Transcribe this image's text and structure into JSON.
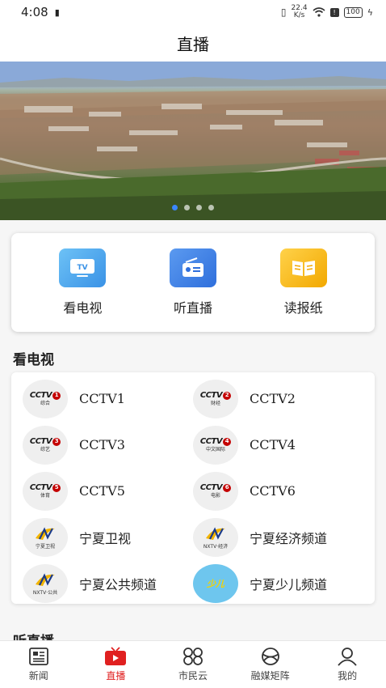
{
  "status": {
    "time": "4:08",
    "speed_value": "22.4",
    "speed_unit": "K/s",
    "battery": "100"
  },
  "header": {
    "title": "直播"
  },
  "quick_actions": [
    {
      "label": "看电视",
      "icon": "tv-icon",
      "color": "#4aa8f0"
    },
    {
      "label": "听直播",
      "icon": "radio-icon",
      "color": "#3c7fe6"
    },
    {
      "label": "读报纸",
      "icon": "newspaper-icon",
      "color": "#f4b300"
    }
  ],
  "tv_section": {
    "title": "看电视",
    "channels": [
      {
        "name": "CCTV1",
        "logo": "1",
        "sub": "综合"
      },
      {
        "name": "CCTV2",
        "logo": "2",
        "sub": "财经"
      },
      {
        "name": "CCTV3",
        "logo": "3",
        "sub": "综艺"
      },
      {
        "name": "CCTV4",
        "logo": "4",
        "sub": "中文国际"
      },
      {
        "name": "CCTV5",
        "logo": "5",
        "sub": "体育"
      },
      {
        "name": "CCTV6",
        "logo": "6",
        "sub": "电影"
      },
      {
        "name": "宁夏卫视",
        "logo": "nx",
        "sub": "宁夏卫视"
      },
      {
        "name": "宁夏经济频道",
        "logo": "nx",
        "sub": "NXTV·经济"
      },
      {
        "name": "宁夏公共频道",
        "logo": "nx",
        "sub": "NXTV·公共"
      },
      {
        "name": "宁夏少儿频道",
        "logo": "kids",
        "sub": "少儿"
      }
    ]
  },
  "next_section": {
    "title": "听直播"
  },
  "bottom_nav": [
    {
      "label": "新闻",
      "icon": "news-icon",
      "active": false
    },
    {
      "label": "直播",
      "icon": "live-tv-icon",
      "active": true
    },
    {
      "label": "市民云",
      "icon": "cloud-grid-icon",
      "active": false
    },
    {
      "label": "融媒矩阵",
      "icon": "media-matrix-icon",
      "active": false
    },
    {
      "label": "我的",
      "icon": "profile-icon",
      "active": false
    }
  ],
  "colors": {
    "accent": "#e02020",
    "dot_active": "#3a86ff"
  }
}
